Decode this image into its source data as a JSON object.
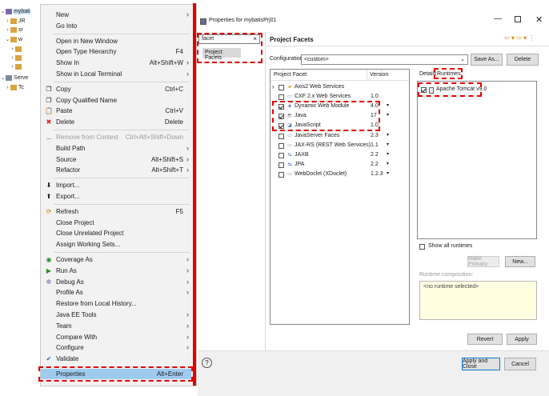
{
  "tree": {
    "items": [
      {
        "label": "mybati",
        "indent": 0,
        "expanded": true
      },
      {
        "label": "JR",
        "indent": 1,
        "expanded": false
      },
      {
        "label": "sr",
        "indent": 1,
        "expanded": false
      },
      {
        "label": "w",
        "indent": 1,
        "expanded": true
      },
      {
        "label": "",
        "indent": 2,
        "expanded": false
      },
      {
        "label": "",
        "indent": 2,
        "expanded": false
      },
      {
        "label": "",
        "indent": 2,
        "expanded": false
      },
      {
        "label": "Serve",
        "indent": 0,
        "expanded": true
      },
      {
        "label": "Tc",
        "indent": 1,
        "expanded": false
      }
    ]
  },
  "menu": {
    "groups": [
      [
        {
          "label": "New",
          "submenu": true
        },
        {
          "label": "Go Into"
        }
      ],
      [
        {
          "label": "Open in New Window"
        },
        {
          "label": "Open Type Hierarchy",
          "shortcut": "F4"
        },
        {
          "label": "Show In",
          "shortcut": "Alt+Shift+W",
          "submenu": true
        },
        {
          "label": "Show in Local Terminal",
          "submenu": true
        }
      ],
      [
        {
          "label": "Copy",
          "shortcut": "Ctrl+C",
          "icon": "copy-icon"
        },
        {
          "label": "Copy Qualified Name",
          "icon": "copy-icon"
        },
        {
          "label": "Paste",
          "shortcut": "Ctrl+V",
          "icon": "paste-icon"
        },
        {
          "label": "Delete",
          "shortcut": "Delete",
          "icon": "delete-icon"
        }
      ],
      [
        {
          "label": "Remove from Context",
          "shortcut": "Ctrl+Alt+Shift+Down",
          "disabled": true,
          "icon": "remove-icon"
        },
        {
          "label": "Build Path",
          "submenu": true
        },
        {
          "label": "Source",
          "shortcut": "Alt+Shift+S",
          "submenu": true
        },
        {
          "label": "Refactor",
          "shortcut": "Alt+Shift+T",
          "submenu": true
        }
      ],
      [
        {
          "label": "Import...",
          "icon": "import-icon"
        },
        {
          "label": "Export...",
          "icon": "export-icon"
        }
      ],
      [
        {
          "label": "Refresh",
          "shortcut": "F5",
          "icon": "refresh-icon"
        },
        {
          "label": "Close Project"
        },
        {
          "label": "Close Unrelated Project"
        },
        {
          "label": "Assign Working Sets..."
        }
      ],
      [
        {
          "label": "Coverage As",
          "submenu": true,
          "icon": "coverage-icon"
        },
        {
          "label": "Run As",
          "submenu": true,
          "icon": "run-icon"
        },
        {
          "label": "Debug As",
          "submenu": true,
          "icon": "debug-icon"
        },
        {
          "label": "Profile As",
          "submenu": true
        },
        {
          "label": "Restore from Local History..."
        },
        {
          "label": "Java EE Tools",
          "submenu": true
        },
        {
          "label": "Team",
          "submenu": true
        },
        {
          "label": "Compare With",
          "submenu": true
        },
        {
          "label": "Configure",
          "submenu": true
        },
        {
          "label": "Validate",
          "icon": "check-icon"
        }
      ],
      [
        {
          "label": "Properties",
          "shortcut": "Alt+Enter",
          "selected": true
        }
      ]
    ]
  },
  "dialog": {
    "title": "Properties for mybatisPrj01",
    "filter_value": "facet",
    "nav_item": "Project Facets",
    "page_title": "Project Facets",
    "configuration_label": "Configuration:",
    "configuration_value": "<custom>",
    "save_as": "Save As...",
    "delete": "Delete",
    "col_facet": "Project Facet",
    "col_version": "Version",
    "facets": [
      {
        "label": "Axis2 Web Services",
        "version": "",
        "checked": false,
        "expander": true,
        "icon": "folder-icon"
      },
      {
        "label": "CXF 2.x Web Services",
        "version": "1.0",
        "checked": false,
        "icon": "facet-icon"
      },
      {
        "label": "Dynamic Web Module",
        "version": "4.0",
        "checked": true,
        "dropdown": true,
        "icon": "web-module-icon"
      },
      {
        "label": "Java",
        "version": "17",
        "checked": true,
        "dropdown": true,
        "icon": "java-icon"
      },
      {
        "label": "JavaScript",
        "version": "1.0",
        "checked": true,
        "icon": "javascript-icon"
      },
      {
        "label": "JavaServer Faces",
        "version": "2.3",
        "checked": false,
        "dropdown": true,
        "icon": "facet-icon"
      },
      {
        "label": "JAX-RS (REST Web Services)",
        "version": "1.1",
        "checked": false,
        "dropdown": true,
        "icon": "facet-icon"
      },
      {
        "label": "JAXB",
        "version": "2.2",
        "checked": false,
        "dropdown": true,
        "icon": "jaxb-icon"
      },
      {
        "label": "JPA",
        "version": "2.2",
        "checked": false,
        "dropdown": true,
        "icon": "jpa-icon"
      },
      {
        "label": "WebDoclet (XDoclet)",
        "version": "1.2.3",
        "checked": false,
        "dropdown": true,
        "icon": "facet-icon"
      }
    ],
    "tab_details": "Details",
    "tab_runtimes": "Runtimes",
    "runtimes": [
      {
        "label": "Apache Tomcat v9.0",
        "checked": true
      }
    ],
    "show_all_runtimes": "Show all runtimes",
    "make_primary": "Make Primary",
    "new_button": "New...",
    "runtime_composition_label": "Runtime composition:",
    "runtime_composition_value": "<no runtime selected>",
    "revert": "Revert",
    "apply": "Apply",
    "apply_and_close": "Apply and Close",
    "cancel": "Cancel",
    "help": "?"
  },
  "colors": {
    "highlight": "#e00000",
    "menu_selection": "#9fcbef",
    "tooltip_bg": "#ffffe1"
  }
}
